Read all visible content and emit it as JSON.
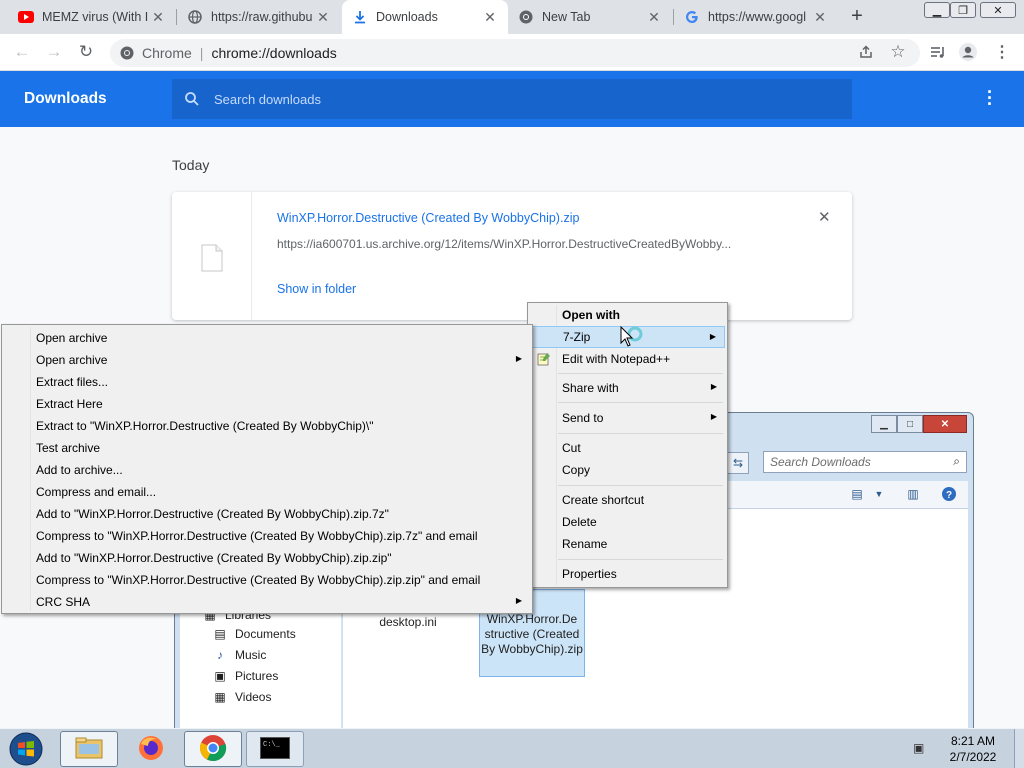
{
  "browser": {
    "tabs": [
      {
        "title": "MEMZ virus (With I",
        "favicon": "youtube-icon"
      },
      {
        "title": "https://raw.githubu",
        "favicon": "globe-icon"
      },
      {
        "title": "Downloads",
        "favicon": "download-icon",
        "active": true
      },
      {
        "title": "New Tab",
        "favicon": "chrome-icon"
      },
      {
        "title": "https://www.googl",
        "favicon": "google-icon"
      }
    ],
    "omnibox": {
      "origin": "Chrome",
      "url": "chrome://downloads"
    }
  },
  "downloads": {
    "header_title": "Downloads",
    "search_placeholder": "Search downloads",
    "section_label": "Today",
    "item": {
      "filename": "WinXP.Horror.Destructive (Created By WobbyChip).zip",
      "url": "https://ia600701.us.archive.org/12/items/WinXP.Horror.DestructiveCreatedByWobby...",
      "action": "Show in folder"
    }
  },
  "explorer": {
    "search_placeholder": "Search Downloads",
    "nav": {
      "libraries": "Libraries",
      "items": [
        "Documents",
        "Music",
        "Pictures",
        "Videos"
      ]
    },
    "files": [
      {
        "name": "desktop.ini"
      },
      {
        "name": "WinXP.Horror.De structive (Created By WobbyChip).zip"
      }
    ]
  },
  "context_menu": {
    "items": [
      {
        "label": "Open with",
        "bold": true
      },
      {
        "label": "7-Zip",
        "submenu": true,
        "highlighted": true
      },
      {
        "label": "Edit with Notepad++"
      },
      {
        "label": "Share with",
        "submenu": true
      },
      {
        "label": "Send to",
        "submenu": true
      },
      {
        "label": "Cut"
      },
      {
        "label": "Copy"
      },
      {
        "label": "Create shortcut"
      },
      {
        "label": "Delete"
      },
      {
        "label": "Rename"
      },
      {
        "label": "Properties"
      }
    ]
  },
  "zip_submenu": {
    "items": [
      {
        "label": "Open archive"
      },
      {
        "label": "Open archive",
        "submenu": true
      },
      {
        "label": "Extract files..."
      },
      {
        "label": "Extract Here"
      },
      {
        "label": "Extract to \"WinXP.Horror.Destructive  (Created By WobbyChip)\\\""
      },
      {
        "label": "Test archive"
      },
      {
        "label": "Add to archive..."
      },
      {
        "label": "Compress and email..."
      },
      {
        "label": "Add to \"WinXP.Horror.Destructive  (Created By WobbyChip).zip.7z\""
      },
      {
        "label": "Compress to \"WinXP.Horror.Destructive  (Created By WobbyChip).zip.7z\" and email"
      },
      {
        "label": "Add to \"WinXP.Horror.Destructive  (Created By WobbyChip).zip.zip\""
      },
      {
        "label": "Compress to \"WinXP.Horror.Destructive  (Created By WobbyChip).zip.zip\" and email"
      },
      {
        "label": "CRC SHA",
        "submenu": true
      }
    ]
  },
  "taskbar": {
    "clock_time": "8:21 AM",
    "clock_date": "2/7/2022",
    "apps": [
      "explorer-icon",
      "firefox-icon",
      "chrome-icon",
      "cmd-icon"
    ]
  },
  "colors": {
    "accent": "#1a73e8",
    "menu_highlight": "#cde4f7"
  }
}
